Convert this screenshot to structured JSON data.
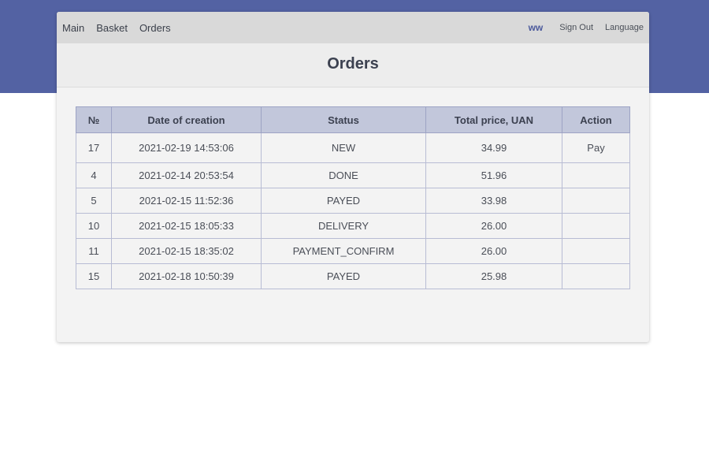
{
  "nav": {
    "links": [
      "Main",
      "Basket",
      "Orders"
    ],
    "user": "ww",
    "sign_out": "Sign Out",
    "language": "Language"
  },
  "page": {
    "title": "Orders"
  },
  "table": {
    "headers": [
      "№",
      "Date of creation",
      "Status",
      "Total price, UAN",
      "Action"
    ],
    "rows": [
      {
        "num": "17",
        "date": "2021-02-19 14:53:06",
        "status": "NEW",
        "price": "34.99",
        "action": "Pay"
      },
      {
        "num": "4",
        "date": "2021-02-14 20:53:54",
        "status": "DONE",
        "price": "51.96",
        "action": ""
      },
      {
        "num": "5",
        "date": "2021-02-15 11:52:36",
        "status": "PAYED",
        "price": "33.98",
        "action": ""
      },
      {
        "num": "10",
        "date": "2021-02-15 18:05:33",
        "status": "DELIVERY",
        "price": "26.00",
        "action": ""
      },
      {
        "num": "11",
        "date": "2021-02-15 18:35:02",
        "status": "PAYMENT_CONFIRM",
        "price": "26.00",
        "action": ""
      },
      {
        "num": "15",
        "date": "2021-02-18 10:50:39",
        "status": "PAYED",
        "price": "25.98",
        "action": ""
      }
    ]
  },
  "colors": {
    "header_band": "#5362a3",
    "navbar_bg": "#d9d9d9",
    "table_header_bg": "#c2c7db",
    "user_accent": "#4c5a9c"
  }
}
